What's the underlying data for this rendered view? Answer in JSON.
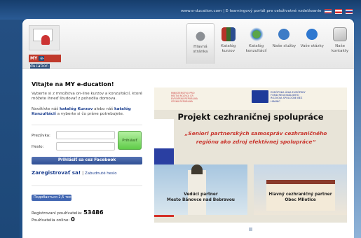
{
  "topbar": {
    "text": "www.e-ducation.com | E-learningový portál pre celoživotné vzdelávanie",
    "flags": [
      "en-flag",
      "cz-flag",
      "sk-flag"
    ]
  },
  "logo": {
    "brand_a": "MY",
    "brand_b": "e-ducation"
  },
  "nav": [
    {
      "label": "Hlavná stránka",
      "icon": "home-icon",
      "active": true
    },
    {
      "label": "Katalóg kurzov",
      "icon": "books-icon"
    },
    {
      "label": "Katalóg konzultácií",
      "icon": "consult-icon"
    },
    {
      "label": "Naše služby",
      "icon": "globe-icon"
    },
    {
      "label": "Vaše otázky",
      "icon": "question-icon"
    },
    {
      "label": "Naše kontakty",
      "icon": "mail-icon"
    }
  ],
  "welcome": {
    "prefix": "Vitajte na ",
    "brand": "MY e-ducation",
    "suffix": "!",
    "p1": "Vyberte si z množstva on-line kurzov a konzultácií, ktoré môžete ihneď študovať z pohodlia domova.",
    "p2_a": "Navštívte náš ",
    "p2_link1": "katalóg Kurzov",
    "p2_b": " alebo náš ",
    "p2_link2": "katalóg Konzultácií",
    "p2_c": " a vyberte si čo práve potrebujete."
  },
  "login": {
    "username_label": "Prezývka:",
    "password_label": "Heslo:",
    "login_button": "Prihlásiť",
    "facebook_button": "Prihlásiť sa cez Facebook",
    "register_link": "Zaregistrovať sa!",
    "separator": " | ",
    "forgot_link": "Zabudnuté heslo"
  },
  "like": {
    "label": "Подобається 2,5 тис."
  },
  "stats": {
    "registered_label": "Registrovaní používatelia:",
    "registered_value": "53486",
    "online_label": "Používatelia online:",
    "online_value": "0"
  },
  "banner": {
    "title": "Projekt cezhraničnej spolupráce",
    "subtitle": "„Seniori partnerských samospráv cezhraničného regiónu ako zdroj efektívnej spolupráce“",
    "caption_left_1": "Vedúci partner",
    "caption_left_2": "Mesto Bánovce nad Bebravou",
    "caption_right_1": "Hlavný cezhraničný partner",
    "caption_right_2": "Obec Milotice",
    "cz_text": "MINISTERSTVO PRO MÍSTNÍ ROZVOJ ČR EVROPSKÁ REPUBLIKA ČESKÁ REPUBLIKA",
    "eu_text": "EURÓPSKA ÚNIA EURÓPSKY FOND REGIONÁLNEHO ROZVOJA SPOLOČNE BEZ HRANÍC"
  },
  "colors": {
    "page_bg": "#1f4f86",
    "link": "#1c3f8f",
    "facebook": "#3b5998",
    "accent_red": "#c0392b"
  }
}
